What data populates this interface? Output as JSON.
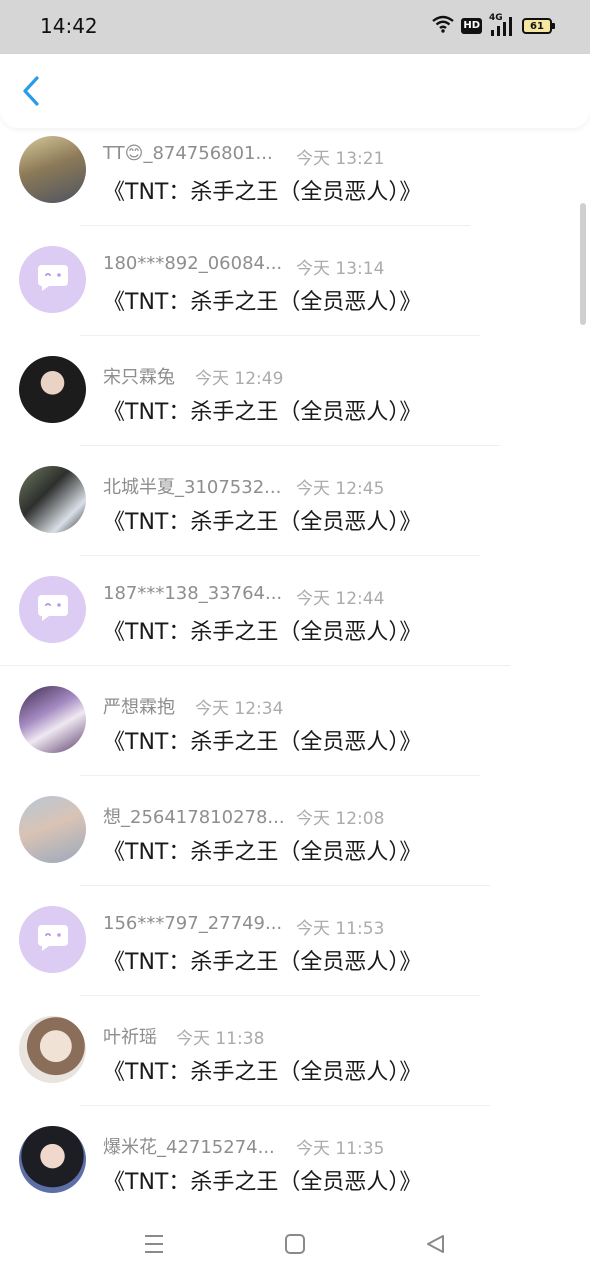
{
  "status_bar": {
    "time": "14:42",
    "hd_label": "HD",
    "network_label": "4G",
    "battery": "61",
    "icons": [
      "wifi-icon",
      "hd-icon",
      "signal-icon",
      "battery-icon"
    ]
  },
  "header": {
    "back_icon": "chevron-left-icon",
    "accent_color": "#2a9be8"
  },
  "list": {
    "items": [
      {
        "nickname": "TT😊_874756801...",
        "time": "今天 13:21",
        "message": "《TNT：杀手之王（全员恶人）》",
        "avatar": "photo"
      },
      {
        "nickname": "180***892_06084...",
        "time": "今天 13:14",
        "message": "《TNT：杀手之王（全员恶人）》",
        "avatar": "default"
      },
      {
        "nickname": "宋只霖兔",
        "time": "今天 12:49",
        "message": "《TNT：杀手之王（全员恶人）》",
        "avatar": "photo"
      },
      {
        "nickname": "北城半夏_3107532...",
        "time": "今天 12:45",
        "message": "《TNT：杀手之王（全员恶人）》",
        "avatar": "photo"
      },
      {
        "nickname": "187***138_33764...",
        "time": "今天 12:44",
        "message": "《TNT：杀手之王（全员恶人）》",
        "avatar": "default"
      },
      {
        "nickname": "严想霖抱",
        "time": "今天 12:34",
        "message": "《TNT：杀手之王（全员恶人）》",
        "avatar": "photo"
      },
      {
        "nickname": "想_256417810278...",
        "time": "今天 12:08",
        "message": "《TNT：杀手之王（全员恶人）》",
        "avatar": "photo"
      },
      {
        "nickname": "156***797_27749...",
        "time": "今天 11:53",
        "message": "《TNT：杀手之王（全员恶人）》",
        "avatar": "default"
      },
      {
        "nickname": "叶祈瑶",
        "time": "今天 11:38",
        "message": "《TNT：杀手之王（全员恶人）》",
        "avatar": "photo"
      },
      {
        "nickname": "爆米花_42715274...",
        "time": "今天 11:35",
        "message": "《TNT：杀手之王（全员恶人）》",
        "avatar": "photo"
      }
    ]
  },
  "bottom_nav": {
    "icons": [
      "menu-icon",
      "home-icon",
      "back-triangle-icon"
    ]
  }
}
